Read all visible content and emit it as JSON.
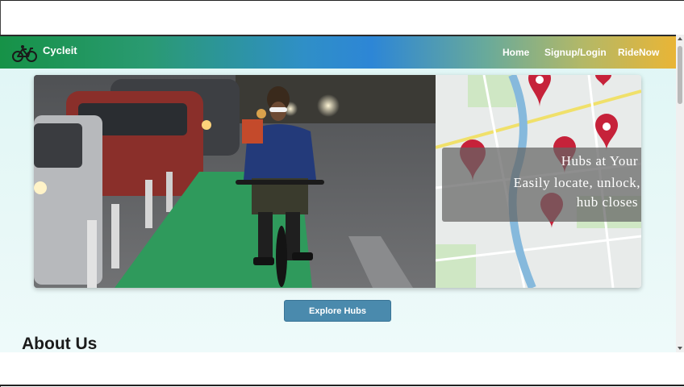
{
  "app": {
    "brand": "Cycleit",
    "logo_icon": "bicycle-icon",
    "accent_green": "#169247",
    "accent_orange": "#e9b536"
  },
  "nav": {
    "links": [
      {
        "label": "Home"
      },
      {
        "label": "Signup/Login"
      },
      {
        "label": "RideNow"
      }
    ]
  },
  "hero": {
    "image_left": "cyclist-in-bike-lane-photo",
    "image_right": "map-with-hub-pins",
    "caption_lines": [
      "Hubs at Your",
      "Easily locate, unlock,",
      "hub closes"
    ]
  },
  "cta": {
    "label": "Explore Hubs",
    "color": "#4a8aad"
  },
  "sections": {
    "about_title": "About Us"
  }
}
